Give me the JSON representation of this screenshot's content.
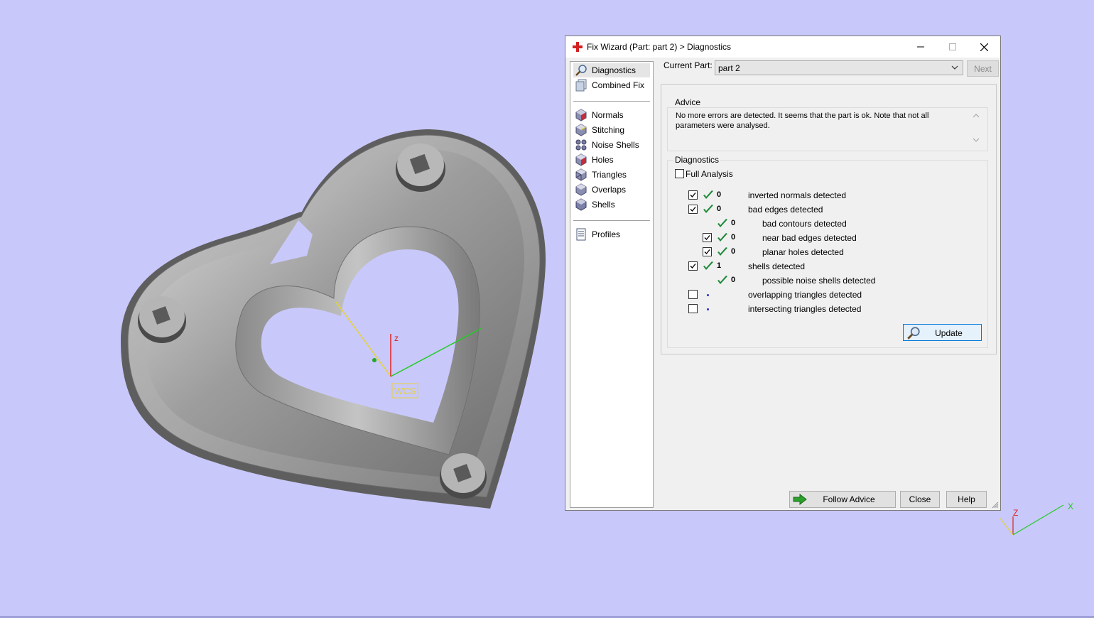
{
  "viewport": {
    "wcs_label": "WCS",
    "axis_z_label": "z",
    "mini_axis": {
      "z": "Z",
      "x": "X"
    },
    "colors": {
      "background": "#c8c8fa",
      "model": "#a9a9a9",
      "x_axis": "#22cc22",
      "y_axis": "#e6d23a",
      "z_axis": "#dd2222",
      "mini_x": "#22cc22",
      "mini_z": "#dd2222"
    }
  },
  "dialog": {
    "title": "Fix Wizard (Part: part 2) > Diagnostics",
    "app_icon": "red-cross-icon",
    "window_buttons": {
      "minimize": "minimize-icon",
      "maximize": "maximize-icon",
      "close": "close-icon"
    },
    "sidebar": {
      "group1": [
        {
          "label": "Diagnostics",
          "icon": "magnifier-icon",
          "selected": true
        },
        {
          "label": "Combined Fix",
          "icon": "combined-fix-icon",
          "selected": false
        }
      ],
      "group2": [
        {
          "label": "Normals",
          "icon": "normals-cube-icon"
        },
        {
          "label": "Stitching",
          "icon": "stitching-cube-icon"
        },
        {
          "label": "Noise Shells",
          "icon": "noise-shells-icon"
        },
        {
          "label": "Holes",
          "icon": "holes-cube-icon"
        },
        {
          "label": "Triangles",
          "icon": "triangles-cube-icon"
        },
        {
          "label": "Overlaps",
          "icon": "overlaps-cube-icon"
        },
        {
          "label": "Shells",
          "icon": "shells-cube-icon"
        }
      ],
      "group3": [
        {
          "label": "Profiles",
          "icon": "profiles-document-icon"
        }
      ]
    },
    "current_part": {
      "label": "Current Part:",
      "value": "part 2"
    },
    "next_label": "Next",
    "advice": {
      "legend": "Advice",
      "text": "No more errors are detected. It seems that the part is ok. Note that not all parameters were analysed."
    },
    "diagnostics": {
      "legend": "Diagnostics",
      "full_analysis": {
        "label": "Full Analysis",
        "checked": false
      },
      "rows": [
        {
          "checkbox": true,
          "checked": true,
          "status": "ok",
          "count": "0",
          "label": "inverted normals detected",
          "indent": false
        },
        {
          "checkbox": true,
          "checked": true,
          "status": "ok",
          "count": "0",
          "label": "bad edges detected",
          "indent": false
        },
        {
          "checkbox": false,
          "checked": false,
          "status": "ok",
          "count": "0",
          "label": "bad contours detected",
          "indent": true
        },
        {
          "checkbox": true,
          "checked": true,
          "status": "ok",
          "count": "0",
          "label": "near bad edges detected",
          "indent": true
        },
        {
          "checkbox": true,
          "checked": true,
          "status": "ok",
          "count": "0",
          "label": "planar holes detected",
          "indent": true
        },
        {
          "checkbox": true,
          "checked": true,
          "status": "ok",
          "count": "1",
          "label": "shells detected",
          "indent": false
        },
        {
          "checkbox": false,
          "checked": false,
          "status": "ok",
          "count": "0",
          "label": "possible noise shells detected",
          "indent": true
        },
        {
          "checkbox": true,
          "checked": false,
          "status": "none",
          "count": "",
          "label": "overlapping triangles detected",
          "indent": false
        },
        {
          "checkbox": true,
          "checked": false,
          "status": "none",
          "count": "",
          "label": "intersecting triangles detected",
          "indent": false
        }
      ],
      "update_label": "Update"
    },
    "buttons": {
      "follow_advice": "Follow Advice",
      "close": "Close",
      "help": "Help"
    }
  }
}
